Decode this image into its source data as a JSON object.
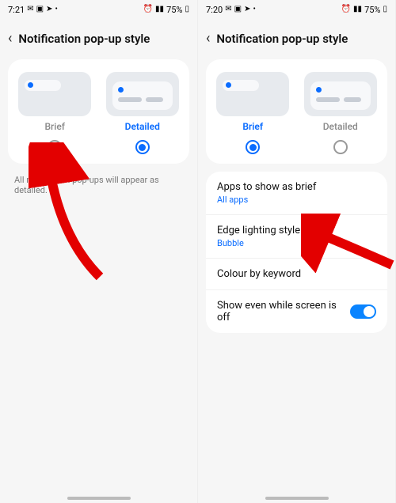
{
  "left": {
    "status": {
      "time": "7:21",
      "battery": "75%"
    },
    "title": "Notification pop-up style",
    "options": {
      "brief": "Brief",
      "detailed": "Detailed"
    },
    "selected": "detailed",
    "hint": "All notification pop-ups will appear as detailed."
  },
  "right": {
    "status": {
      "time": "7:20",
      "battery": "75%"
    },
    "title": "Notification pop-up style",
    "options": {
      "brief": "Brief",
      "detailed": "Detailed"
    },
    "selected": "brief",
    "rows": {
      "apps": {
        "title": "Apps to show as brief",
        "sub": "All apps"
      },
      "edge": {
        "title": "Edge lighting style",
        "sub": "Bubble"
      },
      "colour": {
        "title": "Colour by keyword"
      },
      "show": {
        "title": "Show even while screen is off",
        "toggle": true
      }
    }
  }
}
